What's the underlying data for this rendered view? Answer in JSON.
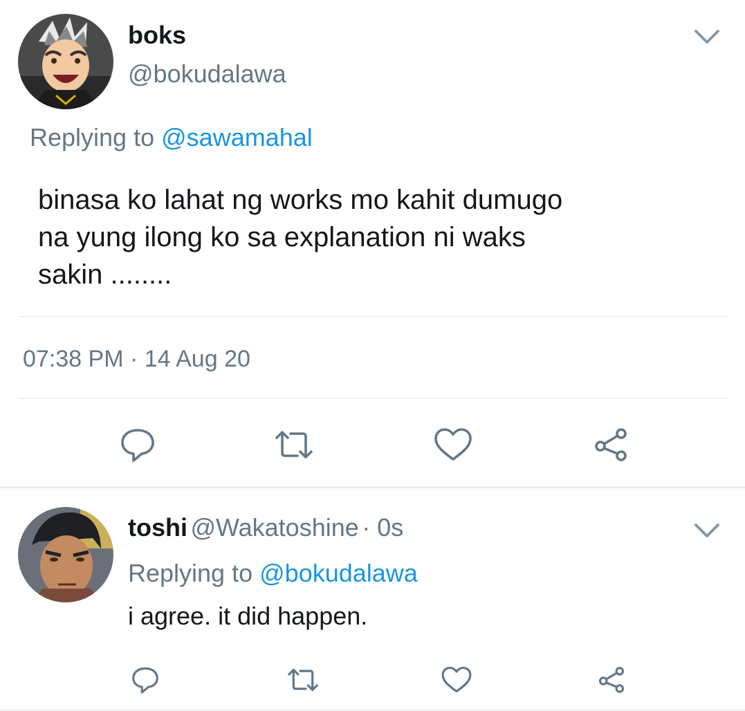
{
  "main_tweet": {
    "display_name": "boks",
    "handle": "@bokudalawa",
    "replying_prefix": "Replying to",
    "replying_to": "@sawamahal",
    "text_lines": [
      "binasa ko lahat ng works mo kahit dumugo",
      "na yung ilong ko sa explanation ni waks",
      "sakin  ........"
    ],
    "timestamp": "07:38 PM · 14 Aug 20",
    "actions": [
      "reply-icon",
      "retweet-icon",
      "like-icon",
      "share-icon"
    ]
  },
  "reply_tweet": {
    "display_name": "toshi",
    "handle": "@Wakatoshine",
    "time": "· 0s",
    "replying_prefix": "Replying to",
    "replying_to": "@bokudalawa",
    "text": "i agree. it did happen.",
    "actions": [
      "reply-icon",
      "retweet-icon",
      "like-icon",
      "share-icon"
    ]
  },
  "colors": {
    "text": "#14171a",
    "secondary": "#657786",
    "link": "#1b95e0",
    "icon": "#657786",
    "divider": "#e1e8ed"
  }
}
